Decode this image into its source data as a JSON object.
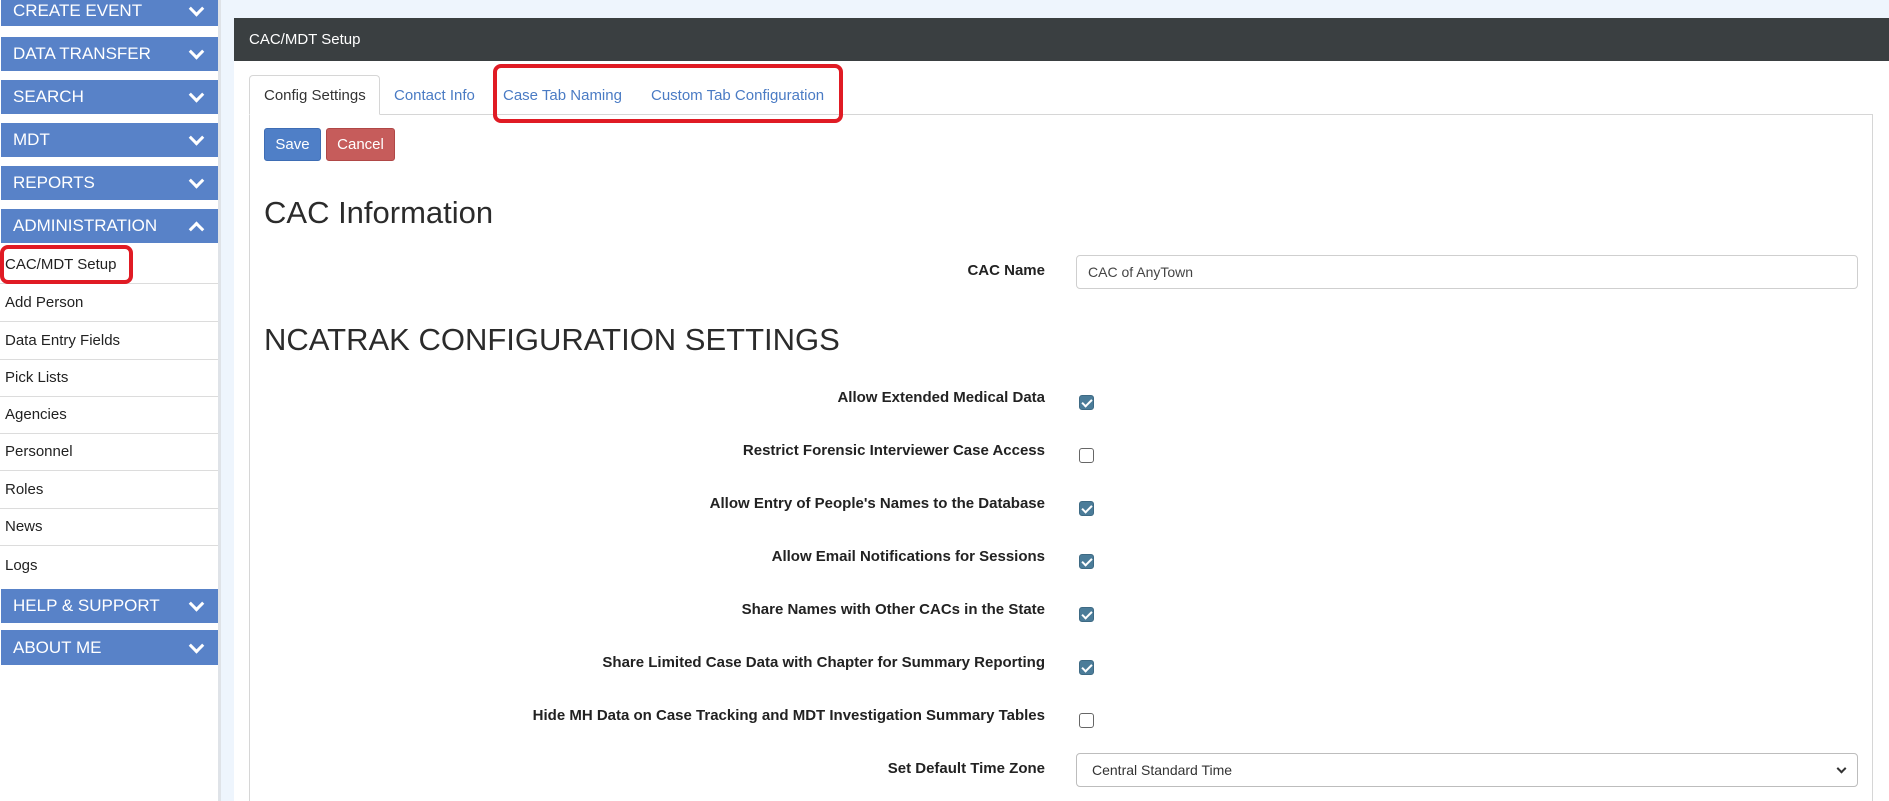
{
  "sidebar": {
    "sections": [
      {
        "label": "CREATE EVENT",
        "expanded": false
      },
      {
        "label": "DATA TRANSFER",
        "expanded": false
      },
      {
        "label": "SEARCH",
        "expanded": false
      },
      {
        "label": "MDT",
        "expanded": false
      },
      {
        "label": "REPORTS",
        "expanded": false
      },
      {
        "label": "ADMINISTRATION",
        "expanded": true
      },
      {
        "label": "HELP & SUPPORT",
        "expanded": false
      },
      {
        "label": "ABOUT ME",
        "expanded": false
      }
    ],
    "admin_items": [
      "CAC/MDT Setup",
      "Add Person",
      "Data Entry Fields",
      "Pick Lists",
      "Agencies",
      "Personnel",
      "Roles",
      "News",
      "Logs"
    ],
    "active_item": "CAC/MDT Setup"
  },
  "panel": {
    "title": "CAC/MDT Setup",
    "tabs": [
      "Config Settings",
      "Contact Info",
      "Case Tab Naming",
      "Custom Tab Configuration"
    ],
    "active_tab": "Config Settings",
    "save_label": "Save",
    "cancel_label": "Cancel"
  },
  "cac_info": {
    "heading": "CAC Information",
    "name_label": "CAC Name",
    "name_value": "CAC of AnyTown"
  },
  "config": {
    "heading": "NCATRAK CONFIGURATION SETTINGS",
    "settings": [
      {
        "label": "Allow Extended Medical Data",
        "checked": true
      },
      {
        "label": "Restrict Forensic Interviewer Case Access",
        "checked": false
      },
      {
        "label": "Allow Entry of People's Names to the Database",
        "checked": true
      },
      {
        "label": "Allow Email Notifications for Sessions",
        "checked": true
      },
      {
        "label": "Share Names with Other CACs in the State",
        "checked": true
      },
      {
        "label": "Share Limited Case Data with Chapter for Summary Reporting",
        "checked": true
      },
      {
        "label": "Hide MH Data on Case Tracking and MDT Investigation Summary Tables",
        "checked": false
      }
    ],
    "timezone_label": "Set Default Time Zone",
    "timezone_value": "Central Standard Time"
  },
  "colors": {
    "nav_header": "#5882c8",
    "panel_header": "#3a3f41",
    "save_button": "#4f7fc7",
    "cancel_button": "#c65c5b",
    "checkbox_checked": "#4b7c99",
    "highlight": "#e01b24",
    "link": "#4a7bc4"
  },
  "icons": {
    "collapsed": "chevron-down-icon",
    "expanded": "chevron-up-icon",
    "select": "chevron-down-icon"
  }
}
